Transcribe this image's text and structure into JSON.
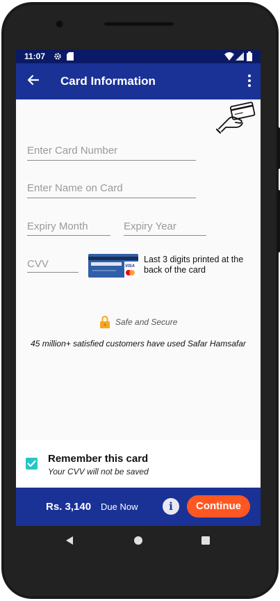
{
  "status_bar": {
    "time": "11:07"
  },
  "app_bar": {
    "title": "Card Information"
  },
  "form": {
    "card_number_placeholder": "Enter Card Number",
    "name_placeholder": "Enter Name on Card",
    "expiry_month_placeholder": "Expiry Month",
    "expiry_year_placeholder": "Expiry Year",
    "cvv_placeholder": "CVV",
    "cvv_hint": "Last 3 digits printed at the back of the card",
    "card_image_label": "VISA"
  },
  "security": {
    "secure_label": "Safe and Secure",
    "customers_text": "45 million+ satisfied customers have used Safar Hamsafar"
  },
  "remember": {
    "title": "Remember this card",
    "subtitle": "Your CVV will not be saved",
    "checked": true
  },
  "bottom_bar": {
    "amount": "Rs. 3,140",
    "due_label": "Due Now",
    "info_label": "i",
    "continue_label": "Continue"
  },
  "colors": {
    "status_bar": "#0b1a66",
    "app_bar": "#1a3296",
    "continue_button": "#ff5722",
    "checkbox": "#26c6c6",
    "lock_icon": "#f5a623"
  }
}
